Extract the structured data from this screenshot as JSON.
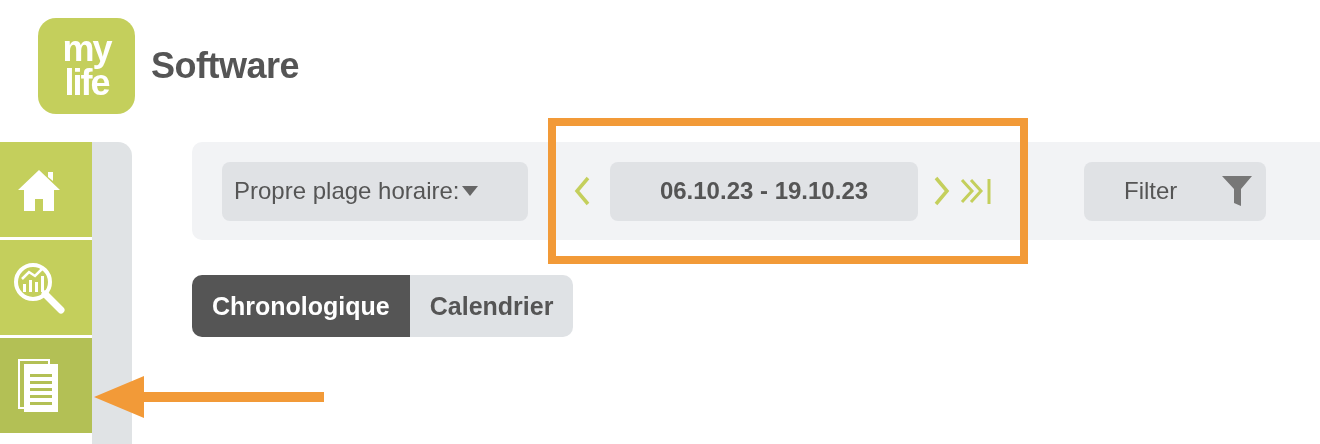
{
  "logo": {
    "lines": [
      "my",
      "life"
    ]
  },
  "app_name": "Software",
  "sidebar": {
    "items": [
      {
        "kind": "home",
        "selected": false
      },
      {
        "kind": "analysis",
        "selected": false
      },
      {
        "kind": "documents",
        "selected": true
      }
    ]
  },
  "toolbar": {
    "range_selector": {
      "label": "Propre plage horaire:"
    },
    "date_range": "06.10.23 - 19.10.23",
    "filter": {
      "label": "Filter"
    }
  },
  "view_tabs": [
    {
      "label": "Chronologique",
      "selected": true
    },
    {
      "label": "Calendrier",
      "selected": false
    }
  ]
}
